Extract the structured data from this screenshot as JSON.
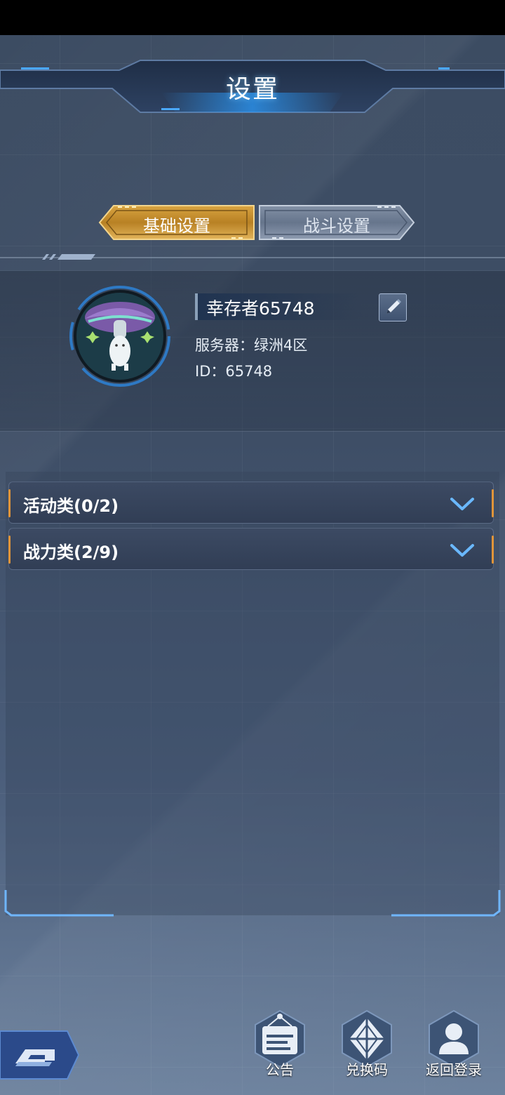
{
  "header": {
    "title": "设置"
  },
  "tabs": [
    {
      "label": "基础设置",
      "active": true
    },
    {
      "label": "战斗设置",
      "active": false
    }
  ],
  "profile": {
    "name": "幸存者65748",
    "server": "服务器：绿洲4区",
    "id": "ID：65748"
  },
  "categories": [
    {
      "label": "活动类(0/2)"
    },
    {
      "label": "战力类(2/9)"
    }
  ],
  "bottom_buttons": [
    {
      "label": "公告",
      "icon": "notice-board-icon"
    },
    {
      "label": "兑换码",
      "icon": "diamond-code-icon"
    },
    {
      "label": "返回登录",
      "icon": "user-icon"
    }
  ],
  "colors": {
    "accent_gold": "#e0a83a",
    "accent_orange": "#e0953a",
    "glow_blue": "#4aa8ff"
  }
}
